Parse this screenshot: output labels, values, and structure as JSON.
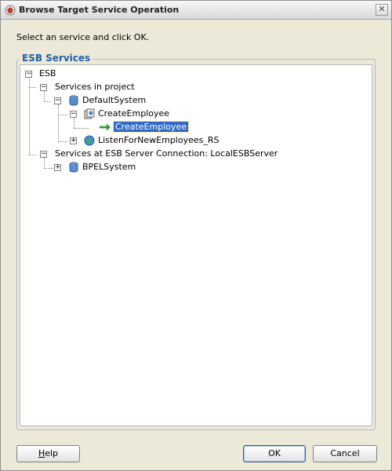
{
  "window": {
    "title": "Browse Target Service Operation",
    "close_symbol": "✕"
  },
  "instruction": "Select an service and click OK.",
  "group": {
    "title": "ESB Services"
  },
  "tree": {
    "root": "ESB",
    "services_in_project": "Services in project",
    "default_system": "DefaultSystem",
    "create_employee_service": "CreateEmployee",
    "create_employee_operation": "CreateEmployee",
    "listen_service": "ListenForNewEmployees_RS",
    "server_services": "Services at ESB Server Connection: LocalESBServer",
    "bpel_system": "BPELSystem"
  },
  "buttons": {
    "help_mnemonic": "H",
    "help_rest": "elp",
    "ok": "OK",
    "cancel": "Cancel"
  }
}
